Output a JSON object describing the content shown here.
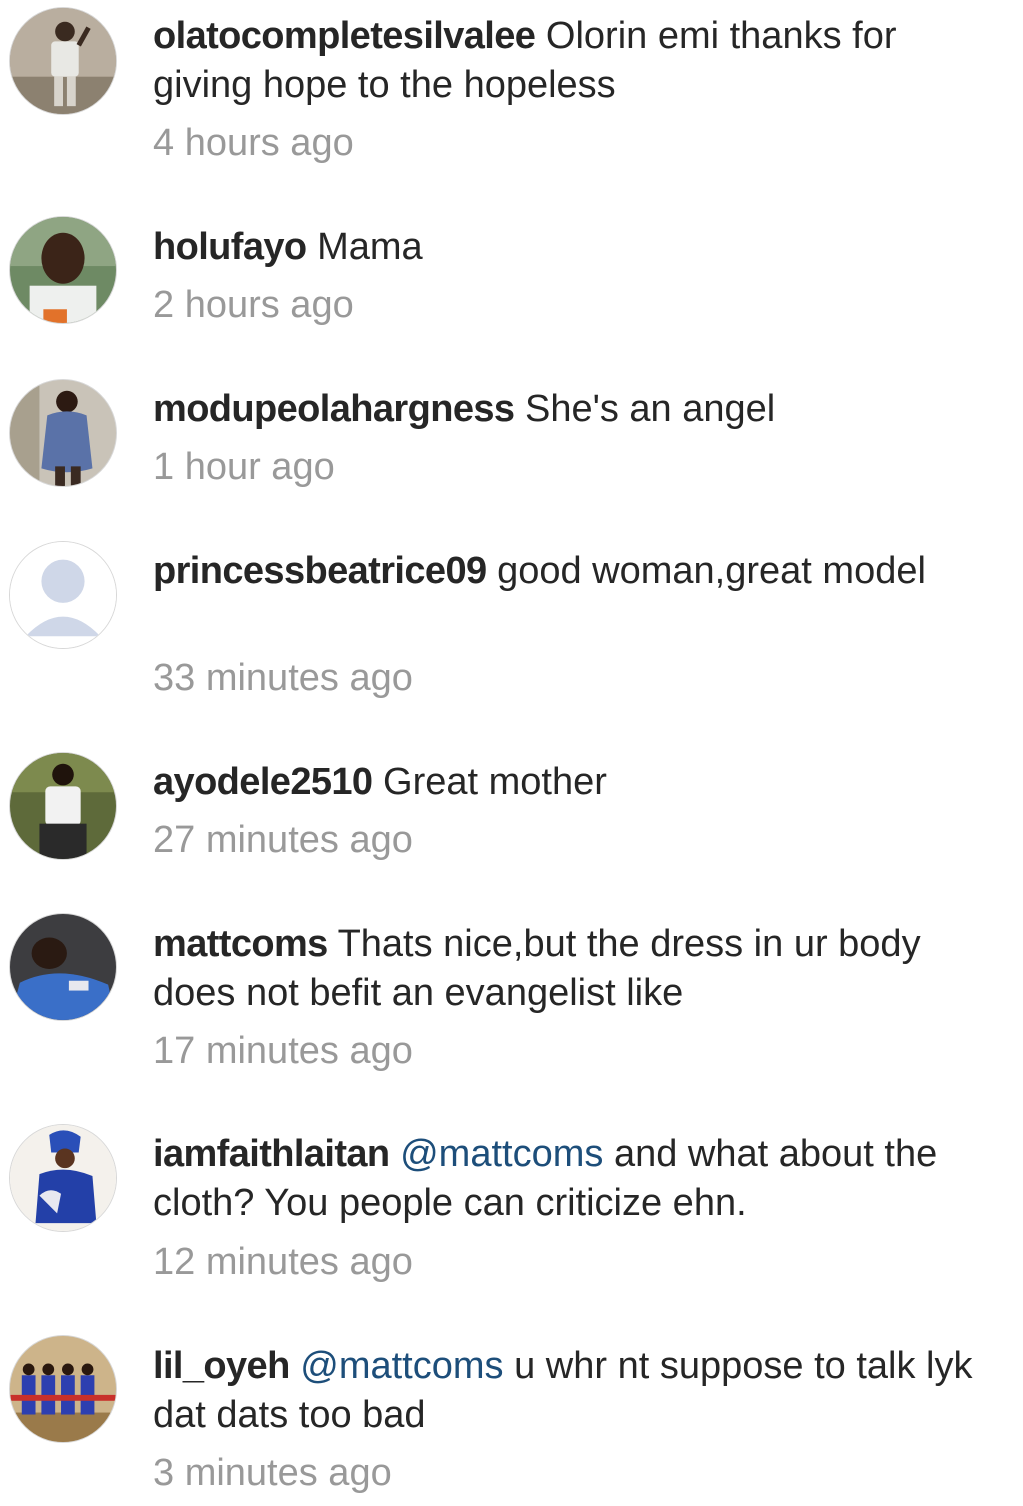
{
  "comments": [
    {
      "username": "olatocompletesilvalee",
      "mention": "",
      "text": "Olorin emi thanks for giving hope to the hopeless",
      "time": "4 hours ago",
      "avatar": "user-photo"
    },
    {
      "username": "holufayo",
      "mention": "",
      "text": "Mama",
      "time": "2 hours ago",
      "avatar": "user-photo"
    },
    {
      "username": "modupeolahargness",
      "mention": "",
      "text": "She's an angel",
      "time": "1 hour ago",
      "avatar": "user-photo"
    },
    {
      "username": "princessbeatrice09",
      "mention": "",
      "text": "good woman,great model",
      "time": "33 minutes ago",
      "avatar": "default-profile-icon"
    },
    {
      "username": "ayodele2510",
      "mention": "",
      "text": "Great mother",
      "time": "27 minutes ago",
      "avatar": "user-photo"
    },
    {
      "username": "mattcoms",
      "mention": "",
      "text": "Thats nice,but the dress in ur body does not befit an evangelist like",
      "time": "17 minutes ago",
      "avatar": "user-photo"
    },
    {
      "username": "iamfaithlaitan",
      "mention": "@mattcoms",
      "text": "and what about the cloth? You people can criticize ehn.",
      "time": "12 minutes ago",
      "avatar": "user-photo"
    },
    {
      "username": "lil_oyeh",
      "mention": "@mattcoms",
      "text": "u whr nt suppose to talk lyk dat dats too bad",
      "time": "3 minutes ago",
      "avatar": "user-photo"
    }
  ],
  "colors": {
    "username": "#262626",
    "text": "#262626",
    "mention": "#1d4e7a",
    "timestamp": "#999999",
    "background": "#ffffff"
  }
}
